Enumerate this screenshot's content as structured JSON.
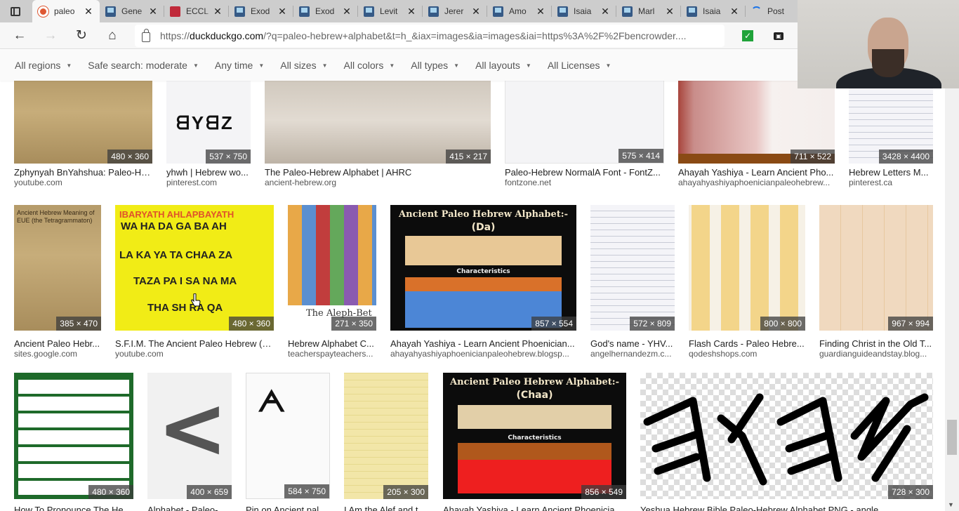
{
  "browser": {
    "tabs": [
      {
        "label": "paleo",
        "favicon": "duckduckgo-icon",
        "active": true
      },
      {
        "label": "Gene",
        "favicon": "book-icon"
      },
      {
        "label": "ECCL",
        "favicon": "red-icon"
      },
      {
        "label": "Exod",
        "favicon": "book-icon"
      },
      {
        "label": "Exod",
        "favicon": "book-icon"
      },
      {
        "label": "Levit",
        "favicon": "book-icon"
      },
      {
        "label": "Jerer",
        "favicon": "book-icon"
      },
      {
        "label": "Amo",
        "favicon": "book-icon"
      },
      {
        "label": "Isaia",
        "favicon": "book-icon"
      },
      {
        "label": "Marl",
        "favicon": "book-icon"
      },
      {
        "label": "Isaia",
        "favicon": "book-icon"
      },
      {
        "label": "Post",
        "favicon": "loading-icon"
      }
    ],
    "tab_close_glyph": "✕",
    "nav": {
      "back": "←",
      "forward": "→",
      "reload": "↻",
      "home": "⌂"
    },
    "url": {
      "prefix": "https://",
      "host": "duckduckgo.com",
      "rest": "/?q=paleo-hebrew+alphabet&t=h_&iax=images&ia=images&iai=https%3A%2F%2Fbencrowder...."
    },
    "extensions": {
      "check": "✓",
      "dark": "▣"
    },
    "favorite_star": "☆"
  },
  "filters": [
    {
      "label": "All regions"
    },
    {
      "label": "Safe search: moderate"
    },
    {
      "label": "Any time"
    },
    {
      "label": "All sizes"
    },
    {
      "label": "All colors"
    },
    {
      "label": "All types"
    },
    {
      "label": "All layouts"
    },
    {
      "label": "All Licenses"
    }
  ],
  "filter_caret": "▼",
  "results": {
    "row1": [
      {
        "title": "Zphynyah BnYahshua: Paleo-He...",
        "source": "youtube.com",
        "dims": "480 × 360"
      },
      {
        "title": "yhwh | Hebrew wo...",
        "source": "pinterest.com",
        "dims": "537 × 750"
      },
      {
        "title": "The Paleo-Hebrew Alphabet | AHRC",
        "source": "ancient-hebrew.org",
        "dims": "415 × 217"
      },
      {
        "title": "Paleo-Hebrew NormalA Font - FontZ...",
        "source": "fontzone.net",
        "dims": "575 × 414"
      },
      {
        "title": "Ahayah Yashiya - Learn Ancient Pho...",
        "source": "ahayahyashiyaphoenicianpaleohebrew...",
        "dims": "711 × 522"
      },
      {
        "title": "Hebrew Letters M...",
        "source": "pinterest.ca",
        "dims": "3428 × 4400"
      }
    ],
    "row2": [
      {
        "title": "Ancient Paleo Hebr...",
        "source": "sites.google.com",
        "dims": "385 × 470",
        "overlay": "Ancient Hebrew Meaning of EUE (the Tetragrammaton)"
      },
      {
        "title": "S.F.I.M. The Ancient Paleo Hebrew (T...",
        "source": "youtube.com",
        "dims": "480 × 360",
        "overlay_header": "IBARYATH  AHLAPBAYATH",
        "overlay_lines": [
          "WA HA DA GA BA AH",
          "LA KA YA TA CHAA ZA",
          "TAZA PA I SA NA MA",
          "THA SH RA QA"
        ]
      },
      {
        "title": "Hebrew Alphabet C...",
        "source": "teacherspayteachers...",
        "dims": "271 × 350",
        "overlay": "The Aleph-Bet"
      },
      {
        "title": "Ahayah Yashiya - Learn Ancient Phoenician...",
        "source": "ahayahyashiyaphoenicianpaleohebrew.blogsp...",
        "dims": "857 × 554",
        "overlay_title": "Ancient Paleo Hebrew Alphabet:-",
        "overlay_sub": "(Da)",
        "overlay_char": "Characteristics"
      },
      {
        "title": "God's name - YHV...",
        "source": "angelhernandezm.c...",
        "dims": "572 × 809"
      },
      {
        "title": "Flash Cards - Paleo Hebre...",
        "source": "qodeshshops.com",
        "dims": "800 × 800"
      },
      {
        "title": "Finding Christ in the Old T...",
        "source": "guardianguideandstay.blog...",
        "dims": "967 × 994"
      }
    ],
    "row3": [
      {
        "title": "How To Pronounce The He...",
        "source": "",
        "dims": "480 × 360"
      },
      {
        "title": "Alphabet - Paleo-H...",
        "source": "",
        "dims": "400 × 659"
      },
      {
        "title": "Pin on Ancient pal...",
        "source": "",
        "dims": "584 × 750"
      },
      {
        "title": "I Am the Alef and t...",
        "source": "",
        "dims": "205 × 300"
      },
      {
        "title": "Ahayah Yashiya - Learn Ancient Phoenicia...",
        "source": "",
        "dims": "856 × 549",
        "overlay_title": "Ancient Paleo Hebrew Alphabet:-",
        "overlay_sub": "(Chaa)",
        "overlay_char": "Characteristics"
      },
      {
        "title": "Yeshua Hebrew Bible Paleo-Hebrew Alphabet PNG - angle...",
        "source": "",
        "dims": "728 × 300",
        "overlay": "𐤉𐤄𐤅𐤄"
      }
    ]
  },
  "scrollbar": {
    "down_arrow": "▼",
    "position_fraction": 0.88
  }
}
